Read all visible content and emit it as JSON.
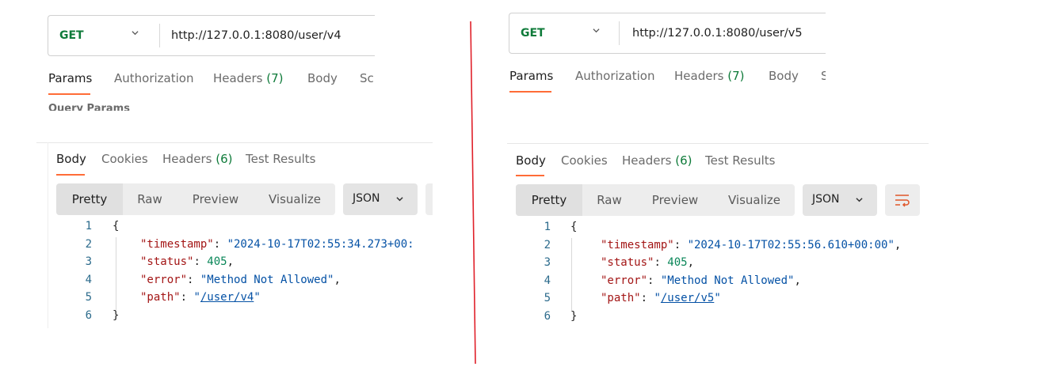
{
  "left": {
    "request": {
      "method": "GET",
      "url": "http://127.0.0.1:8080/user/v4"
    },
    "request_tabs": [
      {
        "label": "Params",
        "count": ""
      },
      {
        "label": "Authorization",
        "count": ""
      },
      {
        "label": "Headers",
        "count": "(7)"
      },
      {
        "label": "Body",
        "count": ""
      },
      {
        "label": "Sc",
        "count": ""
      }
    ],
    "partial_text": "Query Params",
    "response_tabs": [
      {
        "label": "Body",
        "count": ""
      },
      {
        "label": "Cookies",
        "count": ""
      },
      {
        "label": "Headers",
        "count": "(6)"
      },
      {
        "label": "Test Results",
        "count": ""
      }
    ],
    "view_modes": [
      "Pretty",
      "Raw",
      "Preview",
      "Visualize"
    ],
    "format": "JSON",
    "lines": {
      "n": [
        "1",
        "2",
        "3",
        "4",
        "5",
        "6"
      ],
      "open": "{",
      "close": "}",
      "timestamp_key": "\"timestamp\"",
      "timestamp_val": "\"2024-10-17T02:55:34.273+00:",
      "status_key": "\"status\"",
      "status_val": "405",
      "error_key": "\"error\"",
      "error_val": "\"Method Not Allowed\"",
      "path_key": "\"path\"",
      "path_val": "/user/v4"
    }
  },
  "right": {
    "request": {
      "method": "GET",
      "url": "http://127.0.0.1:8080/user/v5"
    },
    "request_tabs": [
      {
        "label": "Params",
        "count": ""
      },
      {
        "label": "Authorization",
        "count": ""
      },
      {
        "label": "Headers",
        "count": "(7)"
      },
      {
        "label": "Body",
        "count": ""
      },
      {
        "label": "S",
        "count": ""
      }
    ],
    "response_tabs": [
      {
        "label": "Body",
        "count": ""
      },
      {
        "label": "Cookies",
        "count": ""
      },
      {
        "label": "Headers",
        "count": "(6)"
      },
      {
        "label": "Test Results",
        "count": ""
      }
    ],
    "view_modes": [
      "Pretty",
      "Raw",
      "Preview",
      "Visualize"
    ],
    "format": "JSON",
    "lines": {
      "n": [
        "1",
        "2",
        "3",
        "4",
        "5",
        "6"
      ],
      "open": "{",
      "close": "}",
      "timestamp_key": "\"timestamp\"",
      "timestamp_val": "\"2024-10-17T02:55:56.610+00:00\"",
      "status_key": "\"status\"",
      "status_val": "405",
      "error_key": "\"error\"",
      "error_val": "\"Method Not Allowed\"",
      "path_key": "\"path\"",
      "path_val": "/user/v5"
    }
  },
  "colors": {
    "accent": "#ff6c37",
    "method_get": "#0f7b3a",
    "divider": "#e0202a"
  }
}
